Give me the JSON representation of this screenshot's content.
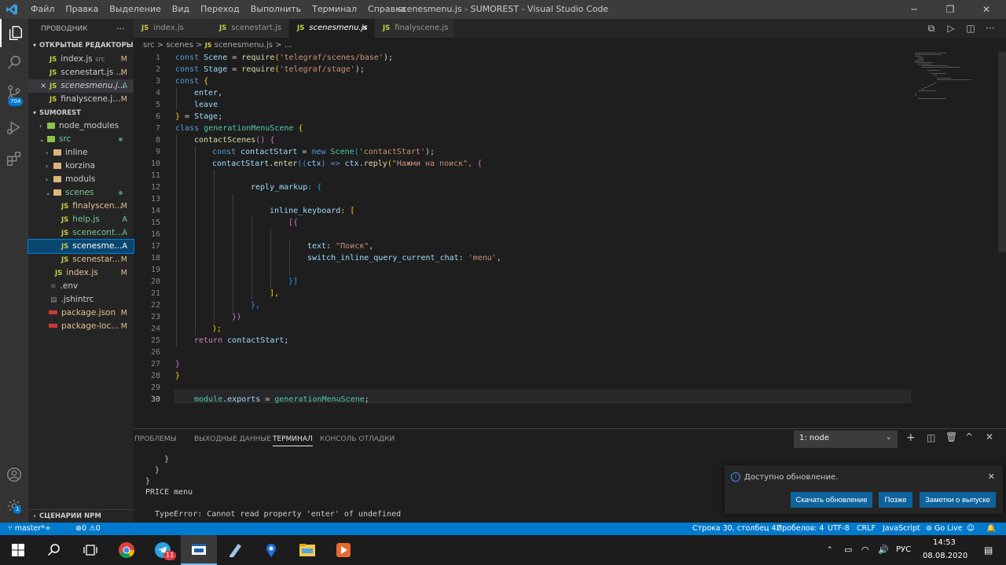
{
  "window": {
    "title": "scenesmenu.js - SUMOREST - Visual Studio Code",
    "menu": [
      "Файл",
      "Правка",
      "Выделение",
      "Вид",
      "Переход",
      "Выполнить",
      "Терминал",
      "Справка"
    ]
  },
  "activity_bar": {
    "scm_badge": "704",
    "settings_badge": "1"
  },
  "sidebar": {
    "header": "ПРОВОДНИК",
    "open_editors_title": "ОТКРЫТЫЕ РЕДАКТОРЫ",
    "open_editors": [
      {
        "icon": "JS",
        "name": "index.js",
        "desc": "src",
        "status": "M"
      },
      {
        "icon": "JS",
        "name": "scenestart.js ...",
        "desc": "",
        "status": "M"
      },
      {
        "icon": "JS",
        "name": "scenesmenu.j...",
        "desc": "",
        "status": "A",
        "close": "×"
      },
      {
        "icon": "JS",
        "name": "finalyscene.j...",
        "desc": "",
        "status": "M"
      }
    ],
    "project_title": "SUMOREST",
    "tree": [
      {
        "name": "node_modules",
        "status": ""
      },
      {
        "name": "src",
        "status": ""
      },
      {
        "name": "inline",
        "status": ""
      },
      {
        "name": "korzina",
        "status": ""
      },
      {
        "name": "moduls",
        "status": ""
      },
      {
        "name": "scenes",
        "status": ""
      },
      {
        "name": "finalyscen...",
        "status": "M"
      },
      {
        "name": "help.js",
        "status": "A"
      },
      {
        "name": "scenecont...",
        "status": "A"
      },
      {
        "name": "scenesme...",
        "status": "A"
      },
      {
        "name": "scenestar...",
        "status": "M"
      },
      {
        "name": "index.js",
        "status": "M"
      },
      {
        "name": ".env",
        "status": ""
      },
      {
        "name": ".jshintrc",
        "status": ""
      },
      {
        "name": "package.json",
        "status": "M"
      },
      {
        "name": "package-loc...",
        "status": "M"
      }
    ],
    "npm_title": "СЦЕНАРИИ NPM"
  },
  "tabs": [
    {
      "icon": "JS",
      "label": "index.js"
    },
    {
      "icon": "JS",
      "label": "scenestart.js"
    },
    {
      "icon": "JS",
      "label": "scenesmenu.js",
      "close": "×"
    },
    {
      "icon": "JS",
      "label": "finalyscene.js"
    }
  ],
  "breadcrumb": {
    "part1": "src",
    "sep": ">",
    "part2": "scenes",
    "icon": "JS",
    "part3": "scenesmenu.js",
    "part4": "..."
  },
  "code": {
    "line_numbers": [
      "1",
      "2",
      "3",
      "4",
      "5",
      "6",
      "7",
      "8",
      "9",
      "10",
      "11",
      "12",
      "13",
      "14",
      "15",
      "16",
      "17",
      "18",
      "19",
      "20",
      "21",
      "22",
      "23",
      "24",
      "25",
      "26",
      "27",
      "28",
      "29",
      "30"
    ],
    "l1": {
      "a": "const ",
      "b": "Scene",
      "c": " = ",
      "d": "require",
      "e": "(",
      "f": "'telegraf/scenes/base'",
      "g": ");"
    },
    "l2": {
      "a": "const ",
      "b": "Stage",
      "c": " = ",
      "d": "require",
      "e": "(",
      "f": "'telegraf/stage'",
      "g": ");"
    },
    "l3": {
      "a": "const ",
      "b": "{"
    },
    "l4": "enter,",
    "l5": "leave",
    "l6": {
      "a": "}",
      "b": " = ",
      "c": "Stage",
      ";": ";"
    },
    "l7": {
      "a": "class ",
      "b": "generationMenuScene",
      "c": " {"
    },
    "l8": {
      "a": "contactScenes",
      "b": "() {"
    },
    "l9": {
      "a": "const ",
      "b": "contactStart",
      "c": " = ",
      "d": "new ",
      "e": "Scene",
      "f": "(",
      "g": "'contactStart'",
      "h": ");"
    },
    "l10": {
      "a": "contactStart",
      "b": ".",
      "c": "enter",
      "d": "((",
      "e": "ctx",
      "f": ") => ",
      "g": "ctx",
      "h": ".",
      "i": "reply",
      "j": "(",
      "k": "\"Нажми на поиск\"",
      "l": ", {"
    },
    "l12": {
      "a": "reply_markup",
      "b": ": {"
    },
    "l14": {
      "a": "inline_keyboard",
      "b": ": ["
    },
    "l15": "[{",
    "l17": {
      "a": "text",
      "b": ": ",
      "c": "\"Поиск\"",
      "d": ","
    },
    "l18": {
      "a": "switch_inline_query_current_chat",
      "b": ": ",
      "c": "'menu'",
      "d": ","
    },
    "l20": "}]",
    "l21": "],",
    "l22": "},",
    "l23": "})",
    "l24": ");",
    "l25": {
      "a": "return ",
      "b": "contactStart",
      ";": ";"
    },
    "l27": "}",
    "l28": "}",
    "l30": {
      "a": "module",
      "b": ".",
      "c": "exports",
      "d": " = ",
      "e": "generationMenuScene",
      ";": ";"
    }
  },
  "panel": {
    "tabs": [
      "ПРОБЛЕМЫ",
      "ВЫХОДНЫЕ ДАННЫЕ",
      "ТЕРМИНАЛ",
      "КОНСОЛЬ ОТЛАДКИ"
    ],
    "terminal_select": "1: node",
    "terminal_lines": [
      "    }",
      "  }",
      "}",
      "PRICE menu",
      "",
      "  TypeError: Cannot read property 'enter' of undefined"
    ]
  },
  "notification": {
    "message": "Доступно обновление.",
    "btn_download": "Скачать обновление",
    "btn_later": "Позже",
    "btn_notes": "Заметки о выпуске"
  },
  "statusbar": {
    "branch": "master*+",
    "errors": "0",
    "warnings": "0",
    "position": "Строка 30, столбец 42",
    "spaces": "Пробелов: 4",
    "encoding": "UTF-8",
    "eol": "CRLF",
    "language": "JavaScript",
    "golive": "Go Live"
  },
  "taskbar": {
    "telegram_badge": "11",
    "lang": "РУС",
    "time": "14:53",
    "date": "08.08.2020"
  }
}
